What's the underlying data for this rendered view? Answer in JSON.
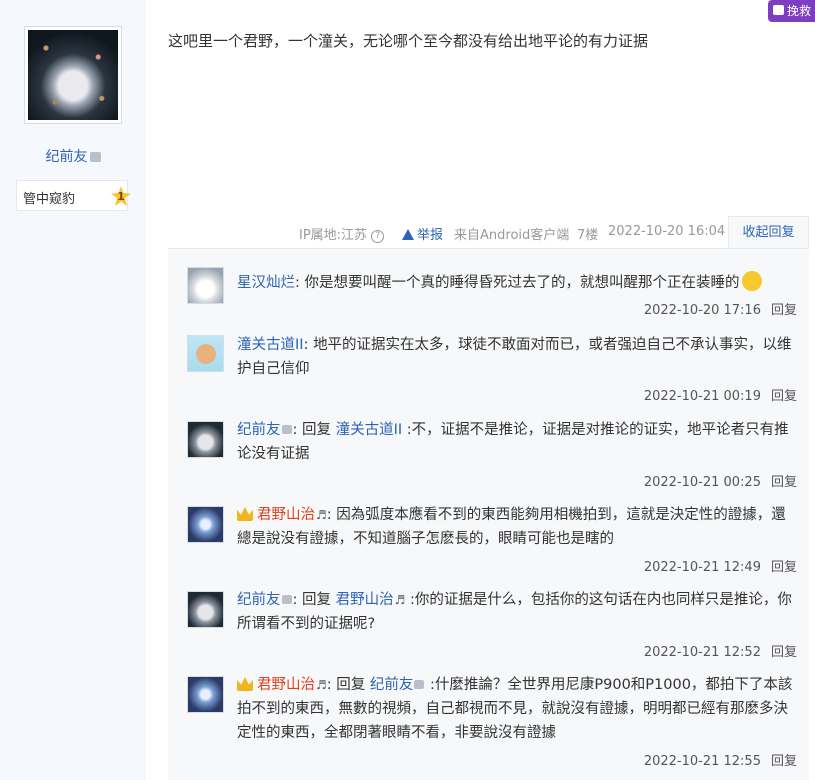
{
  "author": {
    "name": "纪前友",
    "level_name": "管中窥豹",
    "level_number": "1"
  },
  "chat_button_label": "挽救",
  "post": {
    "text": "这吧里一个君野，一个潼关，无论哪个至今都没有给出地平论的有力证据",
    "ip_location": "IP属地:江苏",
    "report_label": "举报",
    "client": "来自Android客户端",
    "floor": "7楼",
    "time": "2022-10-20 16:04",
    "collapse_label": "收起回复"
  },
  "replies": [
    {
      "user": "星汉灿烂",
      "content": "你是想要叫醒一个真的睡得昏死过去了的，就想叫醒那个正在装睡的",
      "time": "2022-10-20 17:16",
      "reply_label": "回复"
    },
    {
      "user": "潼关古道II",
      "content": "地平的证据实在太多，球徒不敢面对而已，或者强迫自己不承认事实，以维护自己信仰",
      "time": "2022-10-21 00:19",
      "reply_label": "回复"
    },
    {
      "user": "纪前友",
      "prefix": "回复",
      "target": "潼关古道II",
      "content": ":不，证据不是推论，证据是对推论的证实，地平论者只有推论没有证据",
      "time": "2022-10-21 00:25",
      "reply_label": "回复"
    },
    {
      "user": "君野山治",
      "user_note": "♬",
      "content": "因為弧度本應看不到的東西能夠用相機拍到，這就是決定性的證據，還總是說没有證據，不知道腦子怎麽長的，眼睛可能也是瞎的",
      "time": "2022-10-21 12:49",
      "reply_label": "回复"
    },
    {
      "user": "纪前友",
      "prefix": "回复",
      "target": "君野山治",
      "target_note": "♬",
      "content": ":你的证据是什么，包括你的这句话在内也同样只是推论，你所谓看不到的证据呢?",
      "time": "2022-10-21 12:52",
      "reply_label": "回复"
    },
    {
      "user": "君野山治",
      "user_note": "♬",
      "prefix": "回复",
      "target": "纪前友",
      "content": ":什麼推論？全世界用尼康P900和P1000，都拍下了本該拍不到的東西，無數的視頻，自己都視而不見，就說沒有證據，明明都已經有那麽多決定性的東西，全都閉著眼睛不看，非要說沒有證據",
      "time": "2022-10-21 12:55",
      "reply_label": "回复"
    }
  ]
}
